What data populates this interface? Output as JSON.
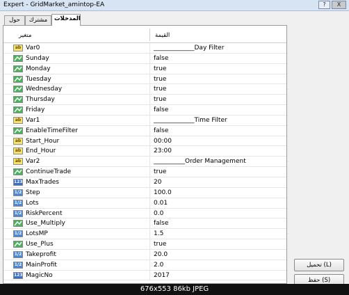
{
  "window": {
    "title": "Expert - GridMarket_amintop-EA",
    "help": "?",
    "close": "X"
  },
  "tabs": [
    {
      "label": "حول"
    },
    {
      "label": "مشترك"
    },
    {
      "label": "المدخلات",
      "active": true
    }
  ],
  "table": {
    "headers": {
      "variable": "متغير",
      "value": "القيمة"
    },
    "rows": [
      {
        "icon": "ab",
        "name": "Var0",
        "value": "_____________Day Filter"
      },
      {
        "icon": "bool",
        "name": "Sunday",
        "value": "false"
      },
      {
        "icon": "bool",
        "name": "Monday",
        "value": "true"
      },
      {
        "icon": "bool",
        "name": "Tuesday",
        "value": "true"
      },
      {
        "icon": "bool",
        "name": "Wednesday",
        "value": "true"
      },
      {
        "icon": "bool",
        "name": "Thursday",
        "value": "true"
      },
      {
        "icon": "bool",
        "name": "Friday",
        "value": "false"
      },
      {
        "icon": "ab",
        "name": "Var1",
        "value": "_____________Time Filter"
      },
      {
        "icon": "bool",
        "name": "EnableTimeFilter",
        "value": "false"
      },
      {
        "icon": "ab",
        "name": "Start_Hour",
        "value": "00:00"
      },
      {
        "icon": "ab",
        "name": "End_Hour",
        "value": "23:00"
      },
      {
        "icon": "ab",
        "name": "Var2",
        "value": "__________Order Management"
      },
      {
        "icon": "bool",
        "name": "ContinueTrade",
        "value": "true"
      },
      {
        "icon": "int",
        "name": "MaxTrades",
        "value": "20"
      },
      {
        "icon": "dbl",
        "name": "Step",
        "value": "100.0"
      },
      {
        "icon": "dbl",
        "name": "Lots",
        "value": "0.01"
      },
      {
        "icon": "dbl",
        "name": "RiskPercent",
        "value": "0.0"
      },
      {
        "icon": "bool",
        "name": "Use_Multiply",
        "value": "false"
      },
      {
        "icon": "dbl",
        "name": "LotsMP",
        "value": "1.5"
      },
      {
        "icon": "bool",
        "name": "Use_Plus",
        "value": "true"
      },
      {
        "icon": "dbl",
        "name": "Takeprofit",
        "value": "20.0"
      },
      {
        "icon": "dbl",
        "name": "MainProfit",
        "value": "2.0"
      },
      {
        "icon": "int",
        "name": "MagicNo",
        "value": "2017"
      }
    ]
  },
  "icon_labels": {
    "ab": "ab",
    "int": "123",
    "dbl": "1/2"
  },
  "buttons": {
    "load": "تحميل (L)",
    "save": "حفظ (S)"
  },
  "statusbar": "676x553  86kb  JPEG"
}
